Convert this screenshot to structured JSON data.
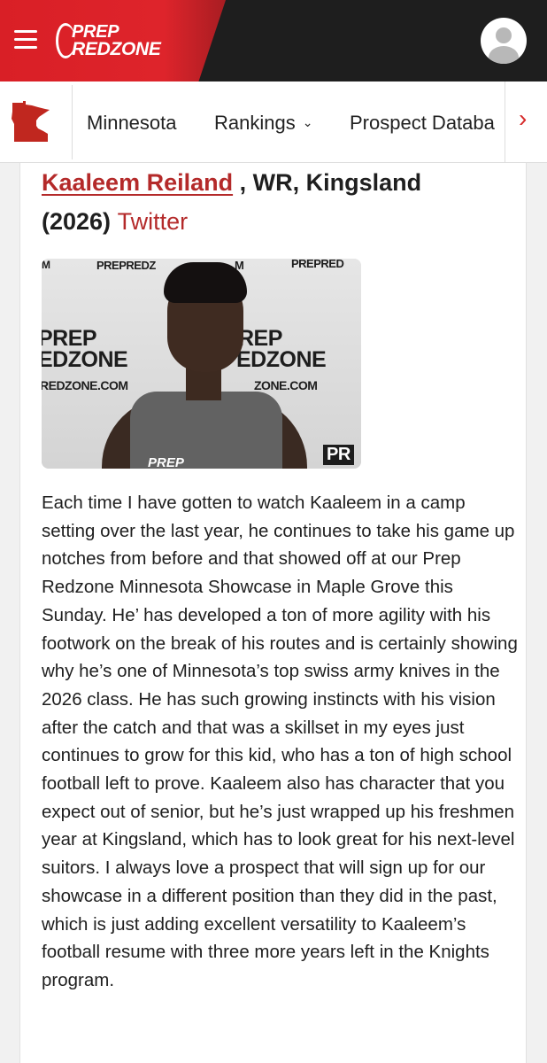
{
  "header": {
    "logo_line1": "PREP",
    "logo_line2": "REDZONE",
    "brand_color": "#d91f26"
  },
  "subnav": {
    "state_icon": "minnesota-state-icon",
    "tabs": [
      {
        "label": "Minnesota"
      },
      {
        "label": "Rankings"
      },
      {
        "label": "Prospect Databa"
      }
    ],
    "next_icon": "chevron-right-icon"
  },
  "article": {
    "player_name": "Kaaleem Reiland",
    "position_school": " , WR, Kingsland",
    "class_year": "(2026)",
    "twitter_label": "Twitter",
    "accent_color": "#b42a2a",
    "photo_backdrop": {
      "top_left": "M",
      "top_mid": "PREPREDZ",
      "top_mid2": "M",
      "top_right": "PREPRED",
      "left_prep": "PREP",
      "left_redzone": "EDZONE",
      "left_url": "REDZONE.COM",
      "right_prep": "REP",
      "right_redzone": "EDZONE",
      "right_url": "ZONE.COM",
      "corner": "PR",
      "tank_logo": "PREP"
    },
    "body": "Each time I have gotten to watch Kaaleem in a camp setting over the last year, he continues to take his game up notches from before and that showed off at our Prep Redzone Minnesota Showcase in Maple Grove this Sunday. He’ has developed a ton of more agility with his footwork on the break of his routes and is certainly showing why he’s one of Minnesota’s top swiss army knives in the 2026 class. He has such growing instincts with his vision after the catch and that was a skillset in my eyes just continues to grow for this kid, who has a ton of high school football left to prove. Kaaleem also has character that you expect out of senior, but he’s just wrapped up his freshmen year at Kingsland, which has to look great for his next-level suitors. I always love a prospect that will sign up for our showcase in a different position than they did in the past, which is just adding excellent versatility to Kaaleem’s football resume with three more years left in the Knights program."
  }
}
